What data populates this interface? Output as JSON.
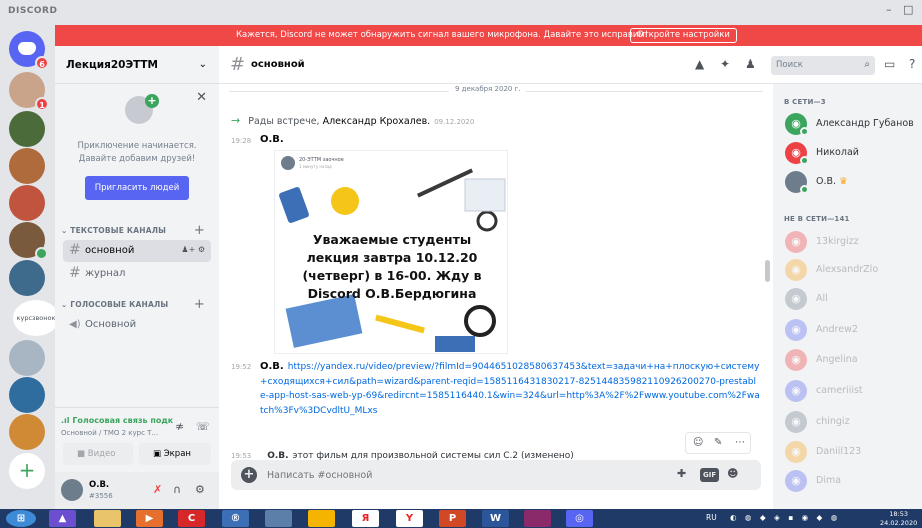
{
  "app": {
    "brand": "DISCORD",
    "minimize": "–",
    "maximize": "□"
  },
  "banner": {
    "message": "Кажется, Discord не может обнаружить сигнал вашего микрофона. Давайте это исправим!",
    "button": "Откройте настройки",
    "color": "#f04747"
  },
  "guilds": {
    "badge1": "6",
    "badge2": "1",
    "text_server": "курсзвонок",
    "add": "+"
  },
  "server": {
    "name": "Лекция20ЭТТМ",
    "chevron": "⌄"
  },
  "invite_card": {
    "line1": "Приключение начинается.",
    "line2": "Давайте добавим друзей!",
    "button": "Пригласить людей",
    "close": "✕"
  },
  "categories": {
    "text": "ТЕКСТОВЫЕ КАНАЛЫ",
    "voice": "ГОЛОСОВЫЕ КАНАЛЫ"
  },
  "channels": {
    "text": [
      {
        "name": "основной",
        "active": true
      },
      {
        "name": "журнал",
        "active": false
      }
    ],
    "voice": [
      {
        "name": "Основной"
      }
    ]
  },
  "voice_status": {
    "title": "Голосовая связь подк",
    "subtitle": "Основной / ТМО 2 курс Т...",
    "video_button": "Видео",
    "screen_button": "Экран"
  },
  "user": {
    "name": "О.В.",
    "tag": "#3556"
  },
  "chat": {
    "channel": "основной",
    "search_placeholder": "Поиск",
    "date_divider": "9 декабря 2020 г.",
    "system": {
      "text": "Рады встрече,",
      "name": "Александр Крохалев.",
      "time": "09.12.2020"
    },
    "msg1": {
      "time": "19:28",
      "author": "О.В.",
      "embed_title": "20-ЭТТМ заочное",
      "embed_sub": "1 минуту назад",
      "embed_text": "Уважаемые студенты лекция завтра 10.12.20 (четверг) в 16-00. Жду в Discord О.В.Бердюгина"
    },
    "msg2": {
      "time": "19:52",
      "author": "О.В.",
      "link": "https://yandex.ru/video/preview/?filmId=9044651028580637453&text=задачи+на+плоскую+систему+сходящихся+сил&path=wizard&parent-reqid=1585116431830217-825144835982110926200270-prestable-app-host-sas-web-yp-69&redircnt=1585116440.1&win=324&url=http%3A%2F%2Fwww.youtube.com%2Fwatch%3Fv%3DCvdltU_MLxs"
    },
    "msg3": {
      "time": "19:53",
      "author": "О.В.",
      "text": "этот фильм для произвольной системы сил С.2 (изменено)"
    },
    "composer_placeholder": "Написать #основной",
    "gif_label": "GIF"
  },
  "members": {
    "online_header": "В СЕТИ—3",
    "offline_header": "НЕ В СЕТИ—141",
    "online": [
      {
        "name": "Александр Губанов",
        "color": "#3ba55d",
        "dot": "#3ba55d"
      },
      {
        "name": "Николай",
        "color": "#ed4245",
        "dot": "#3ba55d"
      },
      {
        "name": "О.В.",
        "color": "#6d7d8c",
        "dot": "#3ba55d",
        "crown": "♛"
      }
    ],
    "offline": [
      {
        "name": "13kirgizz",
        "color": "#ed4245"
      },
      {
        "name": "AlexsandrZlo",
        "color": "#faa61a"
      },
      {
        "name": "All",
        "color": "#747f8d"
      },
      {
        "name": "Andrew2",
        "color": "#5865f2"
      },
      {
        "name": "Angelina",
        "color": "#ed4245"
      },
      {
        "name": "cameriiist",
        "color": "#5865f2"
      },
      {
        "name": "chingiz",
        "color": "#747f8d"
      },
      {
        "name": "Daniil123",
        "color": "#faa61a"
      },
      {
        "name": "Dima",
        "color": "#5865f2"
      }
    ]
  },
  "taskbar": {
    "lang": "RU",
    "time": "18:53",
    "date": "24.02.2020"
  }
}
